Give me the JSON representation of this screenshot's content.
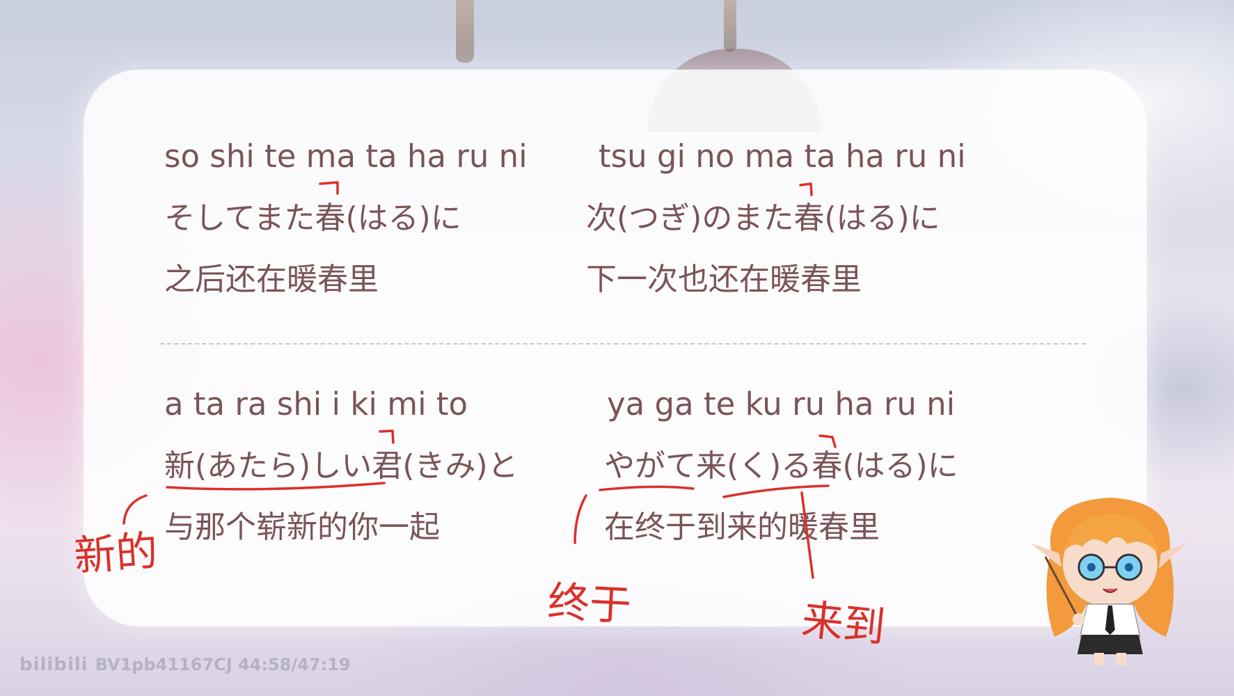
{
  "lyrics": {
    "top_left": {
      "romaji": "so shi te ma ta ha ru ni",
      "japanese": "そしてまた春(はる)に",
      "chinese": "之后还在暖春里"
    },
    "top_right": {
      "romaji": "tsu gi no ma ta ha ru ni",
      "japanese": "次(つぎ)のまた春(はる)に",
      "chinese": "下一次也还在暖春里"
    },
    "bottom_left": {
      "romaji": "a ta ra shi i ki mi to",
      "japanese": "新(あたら)しい君(きみ)と",
      "chinese": "与那个崭新的你一起"
    },
    "bottom_right": {
      "romaji": "ya ga te ku ru ha ru ni",
      "japanese": "やがて来(く)る春(はる)に",
      "chinese": "在终于到来的暖春里"
    }
  },
  "annotations": {
    "note_new": "新的",
    "note_finally": "终于",
    "note_arrive": "来到"
  },
  "watermark": {
    "logo": "bilibili",
    "text": "BV1pb41167CJ 44:58/47:19"
  },
  "colors": {
    "lyric_text": "#7a5456",
    "annotation_ink": "#d9312a"
  },
  "mascot": {
    "icon": "elf-teacher-mascot-icon"
  }
}
